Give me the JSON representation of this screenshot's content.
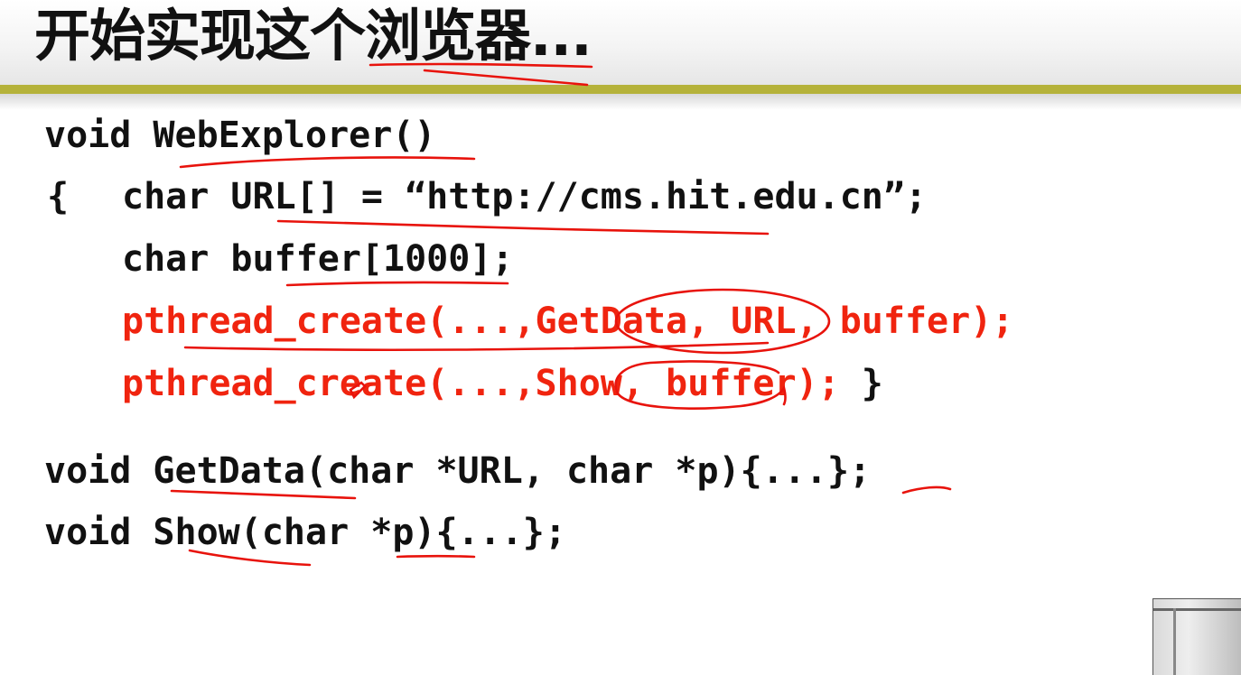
{
  "slide": {
    "title": "开始实现这个浏览器..."
  },
  "code": {
    "line1": "void WebExplorer()",
    "line2_brace": "{",
    "line2_text": "char URL[] = “http://cms.hit.edu.cn”;",
    "line3": "char buffer[1000];",
    "line4": "pthread_create(...,GetData, URL, buffer);",
    "line5_red": "pthread_create(...,Show, buffer);",
    "line5_close": " }",
    "line6": "void GetData(char *URL, char *p){...};",
    "line7": "void Show(char *p){...};"
  },
  "colors": {
    "accent_rule": "#b5b23a",
    "highlight_code": "#f0240f",
    "annotation_ink": "#e8130c",
    "code_text": "#111111"
  }
}
